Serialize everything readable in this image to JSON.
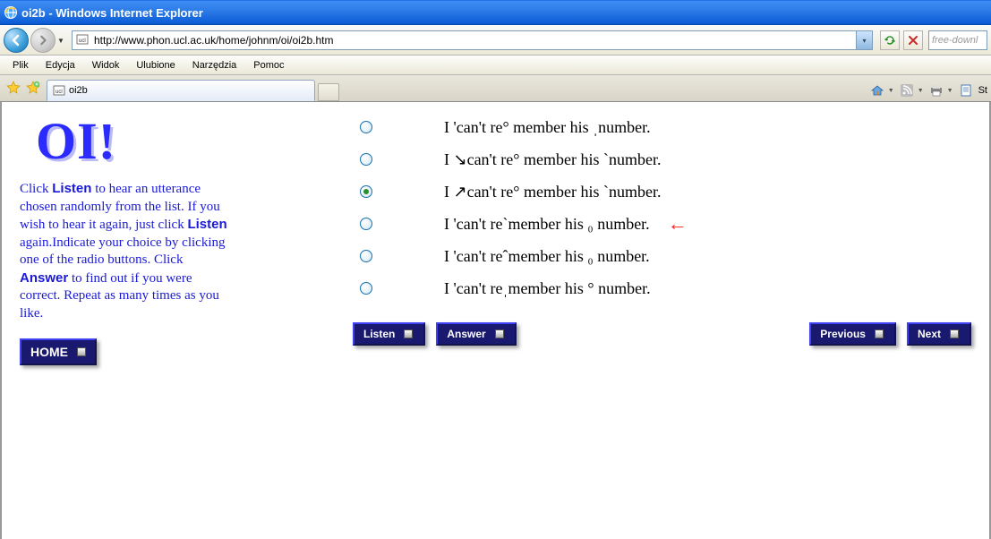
{
  "window": {
    "title": "oi2b - Windows Internet Explorer"
  },
  "address": {
    "url": "http://www.phon.ucl.ac.uk/home/johnm/oi/oi2b.htm"
  },
  "search": {
    "placeholder": "free-downl"
  },
  "menus": [
    "Plik",
    "Edycja",
    "Widok",
    "Ulubione",
    "Narzędzia",
    "Pomoc"
  ],
  "tab": {
    "label": "oi2b"
  },
  "page": {
    "logo": "OI!",
    "instructions_html": "Click <b>Listen</b> to hear an utterance chosen randomly from the list. If you wish to hear it again, just click <b>Listen</b> again.Indicate your choice by clicking one of the radio buttons. Click <b>Answer</b> to find out if you were correct. Repeat as many times as you like.",
    "home_label": "HOME",
    "options": [
      {
        "text": "I 'can't re° member his ˌnumber.",
        "selected": false,
        "arrow": false
      },
      {
        "text": "I ↘can't re° member his ˋnumber.",
        "selected": false,
        "arrow": false
      },
      {
        "text": "I ↗can't re° member his ˋnumber.",
        "selected": true,
        "arrow": false
      },
      {
        "text": "I 'can't reˋmember his ₀ number.",
        "selected": false,
        "arrow": true
      },
      {
        "text": "I 'can't reˆmember his ₀ number.",
        "selected": false,
        "arrow": false
      },
      {
        "text": "I 'can't reˌmember his ° number.",
        "selected": false,
        "arrow": false
      }
    ],
    "buttons": {
      "listen": "Listen",
      "answer": "Answer",
      "previous": "Previous",
      "next": "Next"
    }
  }
}
